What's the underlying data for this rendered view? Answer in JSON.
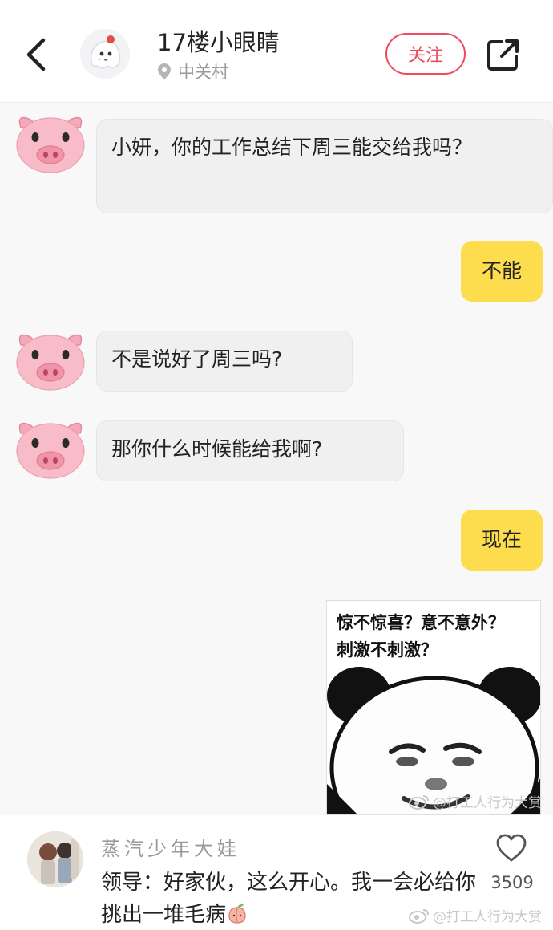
{
  "header": {
    "title": "17楼小眼睛",
    "location": "中关村",
    "follow_label": "关注"
  },
  "messages": [
    {
      "side": "left",
      "text": "小妍，你的工作总结下周三能交给我吗？"
    },
    {
      "side": "right",
      "text": "不能"
    },
    {
      "side": "left",
      "text": "不是说好了周三吗?"
    },
    {
      "side": "left",
      "text": "那你什么时候能给我啊?"
    },
    {
      "side": "right",
      "text": "现在"
    }
  ],
  "meme": {
    "line1": "惊不惊喜？意不意外？",
    "line2": "刺激不刺激？"
  },
  "watermark": "@打工人行为大赏",
  "comment": {
    "username": "蒸汽少年大娃",
    "text": "领导：好家伙，这么开心。我一会必给你挑出一堆毛病",
    "likes": "3509"
  },
  "colors": {
    "accent": "#ef4b5d",
    "right_bubble": "#fddc4e",
    "left_bubble": "#f0f0f0"
  },
  "icons": {
    "back": "chevron-left-icon",
    "share": "share-external-icon",
    "location": "location-pin-icon",
    "like": "heart-outline-icon",
    "sender_avatar": "pig-face-emoji",
    "comment_emoji": "peach-emoji"
  }
}
